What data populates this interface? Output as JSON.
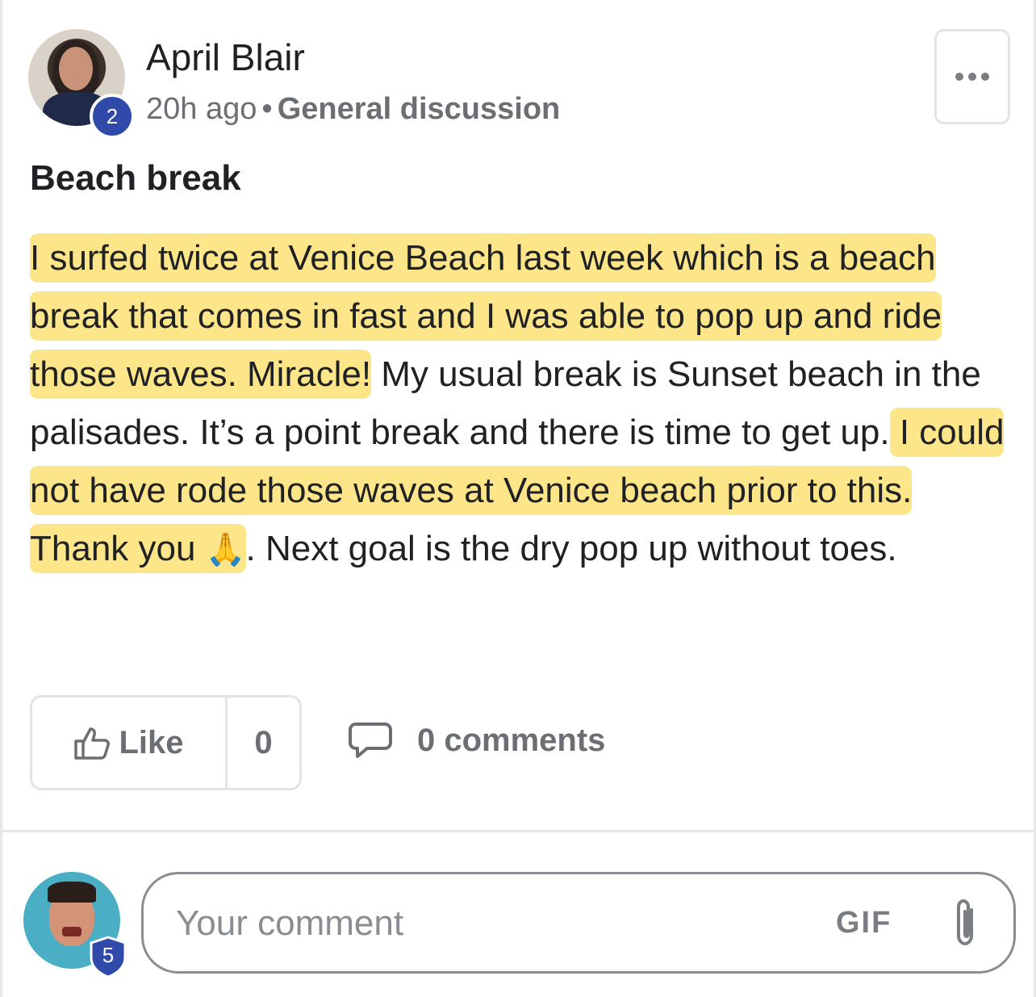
{
  "post": {
    "author": "April Blair",
    "author_level": "2",
    "time_ago": "20h ago",
    "separator": "•",
    "category": "General discussion",
    "title": "Beach break",
    "body": {
      "hl1": "I surfed twice at Venice Beach last week which is a beach break that comes in fast and I was able to pop up and ride those waves. Miracle!",
      "t1": " My usual break is Sunset beach in the palisades. It’s a point break and there is time to get up.",
      "hl2": " I could not have rode those waves at Venice beach prior to this. Thank you ",
      "emoji": "🙏",
      "t2": ". Next goal is the dry pop up without toes."
    }
  },
  "actions": {
    "like_label": "Like",
    "like_count": "0",
    "comments_label": "0 comments"
  },
  "composer": {
    "user_level": "5",
    "placeholder": "Your comment",
    "gif_label": "GIF"
  },
  "icons": {
    "more": "more-horizontal-icon",
    "like": "thumbs-up-icon",
    "comment": "comment-bubble-icon",
    "attach": "paperclip-icon"
  },
  "colors": {
    "highlight": "#fde68a",
    "badge": "#2f4aa8",
    "muted_text": "#6b6e73"
  }
}
